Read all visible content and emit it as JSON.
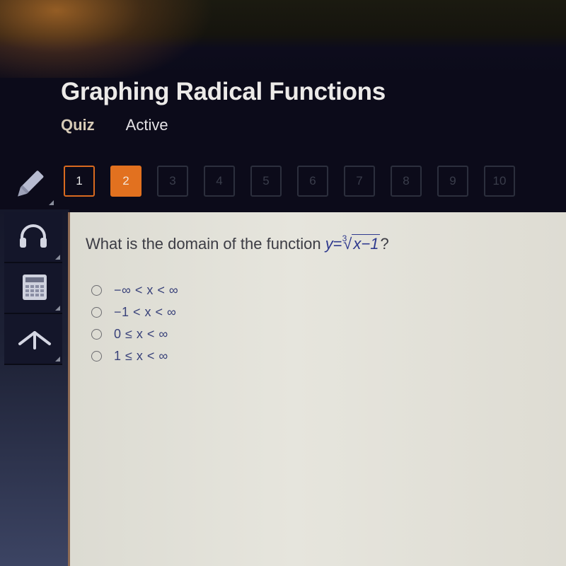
{
  "header": {
    "title": "Graphing Radical Functions",
    "type": "Quiz",
    "status": "Active"
  },
  "toolbar": {
    "tools": [
      {
        "icon": "pencil-icon"
      }
    ],
    "questions": [
      {
        "label": "1",
        "state": "visited"
      },
      {
        "label": "2",
        "state": "current"
      },
      {
        "label": "3",
        "state": "unvisited"
      },
      {
        "label": "4",
        "state": "unvisited"
      },
      {
        "label": "5",
        "state": "unvisited"
      },
      {
        "label": "6",
        "state": "unvisited"
      },
      {
        "label": "7",
        "state": "unvisited"
      },
      {
        "label": "8",
        "state": "unvisited"
      },
      {
        "label": "9",
        "state": "unvisited"
      },
      {
        "label": "10",
        "state": "unvisited"
      }
    ]
  },
  "sidebar": {
    "tools": [
      {
        "icon": "headphones-icon",
        "name": "audio"
      },
      {
        "icon": "calculator-icon",
        "name": "calculator"
      },
      {
        "icon": "arrow-up-icon",
        "name": "reference"
      }
    ]
  },
  "question": {
    "prefix": "What is the domain of the function ",
    "func_lhs": "y",
    "equals": "=",
    "root_index": "3",
    "radicand": "x−1",
    "suffix": "?",
    "options": [
      {
        "label": "−∞ < x < ∞",
        "selected": false
      },
      {
        "label": "−1 < x < ∞",
        "selected": false
      },
      {
        "label": "0 ≤ x < ∞",
        "selected": false
      },
      {
        "label": "1 ≤ x < ∞",
        "selected": false
      }
    ]
  },
  "colors": {
    "accent": "#e2711f",
    "math_text": "#2f3a8e",
    "content_bg": "#e2e1d9"
  }
}
